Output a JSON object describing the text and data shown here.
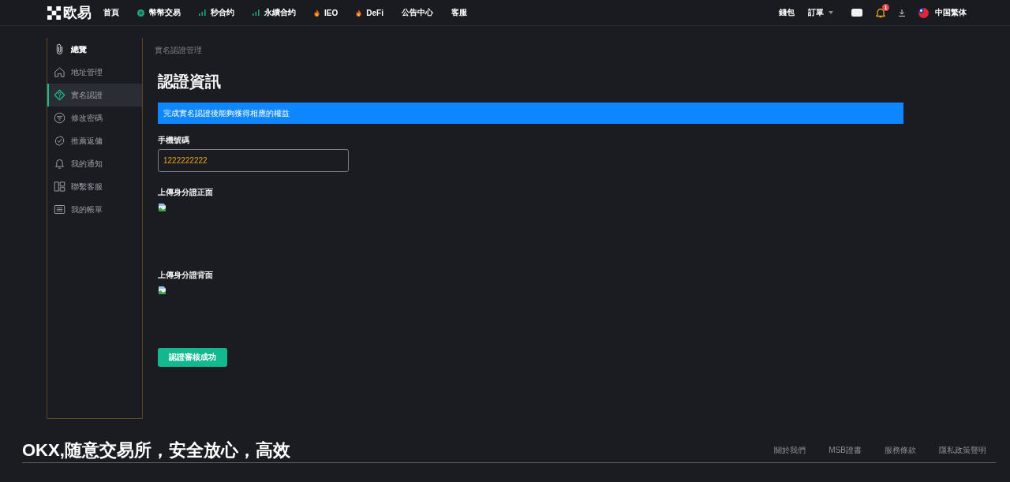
{
  "topbar": {
    "logo": "欧易",
    "nav": [
      {
        "label": "首頁",
        "kind": "plain"
      },
      {
        "label": "幣幣交易",
        "kind": "coin"
      },
      {
        "label": "秒合约",
        "kind": "bars"
      },
      {
        "label": "永續合约",
        "kind": "bars"
      },
      {
        "label": "IEO",
        "kind": "flame"
      },
      {
        "label": "DeFi",
        "kind": "flame"
      },
      {
        "label": "公告中心",
        "kind": "plain"
      },
      {
        "label": "客服",
        "kind": "plain"
      }
    ],
    "wallet": "錢包",
    "orders": "訂單",
    "notification_count": "1",
    "language": "中国繁体"
  },
  "sidebar": {
    "items": [
      {
        "label": "總覽",
        "kind": "heading",
        "selected": false
      },
      {
        "label": "地址管理",
        "kind": "link",
        "selected": false
      },
      {
        "label": "實名認證",
        "kind": "link",
        "selected": true
      },
      {
        "label": "修改密碼",
        "kind": "link",
        "selected": false
      },
      {
        "label": "推薦返傭",
        "kind": "link",
        "selected": false
      },
      {
        "label": "我的通知",
        "kind": "link",
        "selected": false
      },
      {
        "label": "聯繫客服",
        "kind": "link",
        "selected": false
      },
      {
        "label": "我的帳單",
        "kind": "link",
        "selected": false
      }
    ]
  },
  "main": {
    "breadcrumb": "實名認證管理",
    "title": "認證資訊",
    "notice": "完成實名認證後能夠獲得相應的權益",
    "phone": {
      "label": "手機號碼",
      "value": "1222222222"
    },
    "uploads": [
      {
        "label": "上傳身分證正面"
      },
      {
        "label": "上傳身分證背面"
      }
    ],
    "button": "認證審核成功"
  },
  "footer": {
    "slogan": "OKX,随意交易所，安全放心，高效",
    "links": [
      "關於我們",
      "MSB證書",
      "服務條款",
      "隱私政策聲明"
    ]
  }
}
